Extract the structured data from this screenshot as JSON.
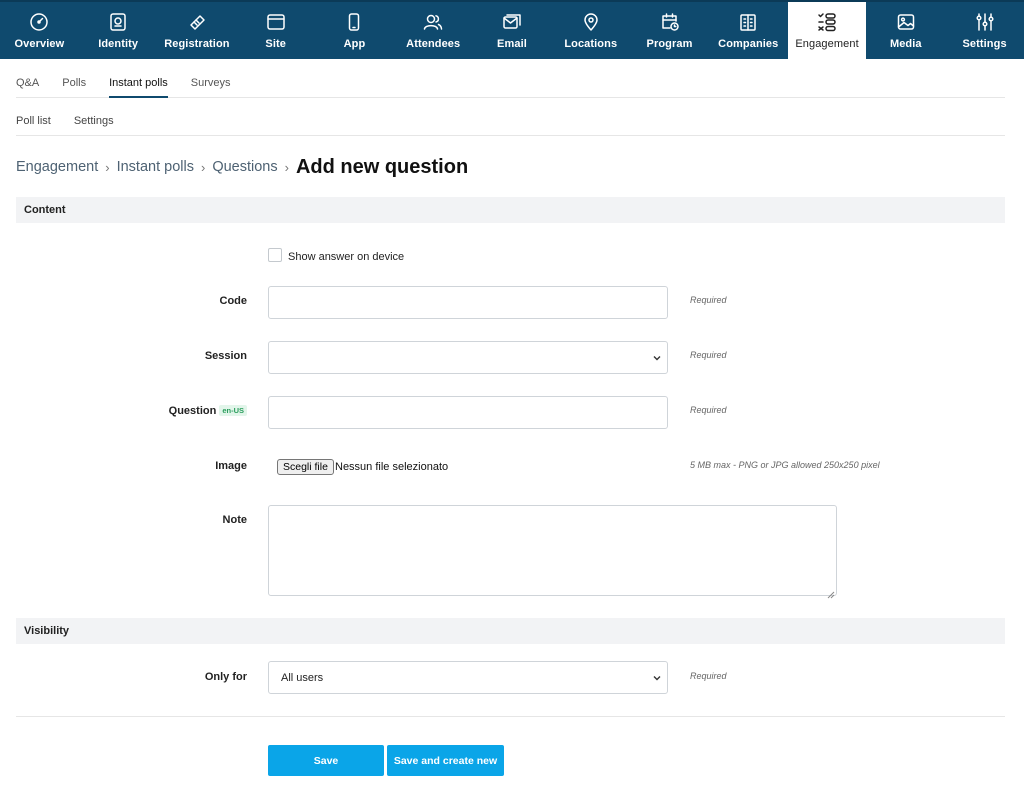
{
  "nav": {
    "items": [
      {
        "label": "Overview",
        "icon": "gauge-icon"
      },
      {
        "label": "Identity",
        "icon": "id-card-icon"
      },
      {
        "label": "Registration",
        "icon": "ticket-icon"
      },
      {
        "label": "Site",
        "icon": "browser-window-icon"
      },
      {
        "label": "App",
        "icon": "smartphone-icon"
      },
      {
        "label": "Attendees",
        "icon": "users-icon"
      },
      {
        "label": "Email",
        "icon": "email-icon"
      },
      {
        "label": "Locations",
        "icon": "location-pin-icon"
      },
      {
        "label": "Program",
        "icon": "calendar-clock-icon"
      },
      {
        "label": "Companies",
        "icon": "building-icon"
      },
      {
        "label": "Engagement",
        "icon": "engagement-list-icon"
      },
      {
        "label": "Media",
        "icon": "image-icon"
      },
      {
        "label": "Settings",
        "icon": "sliders-icon"
      }
    ],
    "active": "Engagement"
  },
  "subtabs": [
    "Q&A",
    "Polls",
    "Instant polls",
    "Surveys"
  ],
  "subtabs_active": "Instant polls",
  "subtabs2": [
    "Poll list",
    "Settings"
  ],
  "breadcrumb": {
    "items": [
      "Engagement",
      "Instant polls",
      "Questions"
    ],
    "separator": "›",
    "current": "Add new question"
  },
  "sections": {
    "content": "Content",
    "visibility": "Visibility"
  },
  "form": {
    "show_answer_label": "Show answer on device",
    "show_answer_checked": false,
    "code_label": "Code",
    "code_value": "",
    "code_hint": "Required",
    "session_label": "Session",
    "session_value": "",
    "session_hint": "Required",
    "question_label": "Question",
    "question_lang": "en-US",
    "question_value": "",
    "question_hint": "Required",
    "image_label": "Image",
    "image_button": "Scegli file",
    "image_status": "Nessun file selezionato",
    "image_hint": "5 MB max - PNG or JPG allowed 250x250 pixel",
    "note_label": "Note",
    "note_value": "",
    "only_for_label": "Only for",
    "only_for_value": "All users",
    "only_for_hint": "Required"
  },
  "actions": {
    "save": "Save",
    "save_and_new": "Save and create new"
  },
  "colors": {
    "nav_background": "#0f4a6e",
    "primary_button": "#0aa5e8",
    "section_background": "#f2f3f5",
    "lang_badge_text": "#2a9d5c",
    "lang_badge_background": "#e2f5ea"
  }
}
